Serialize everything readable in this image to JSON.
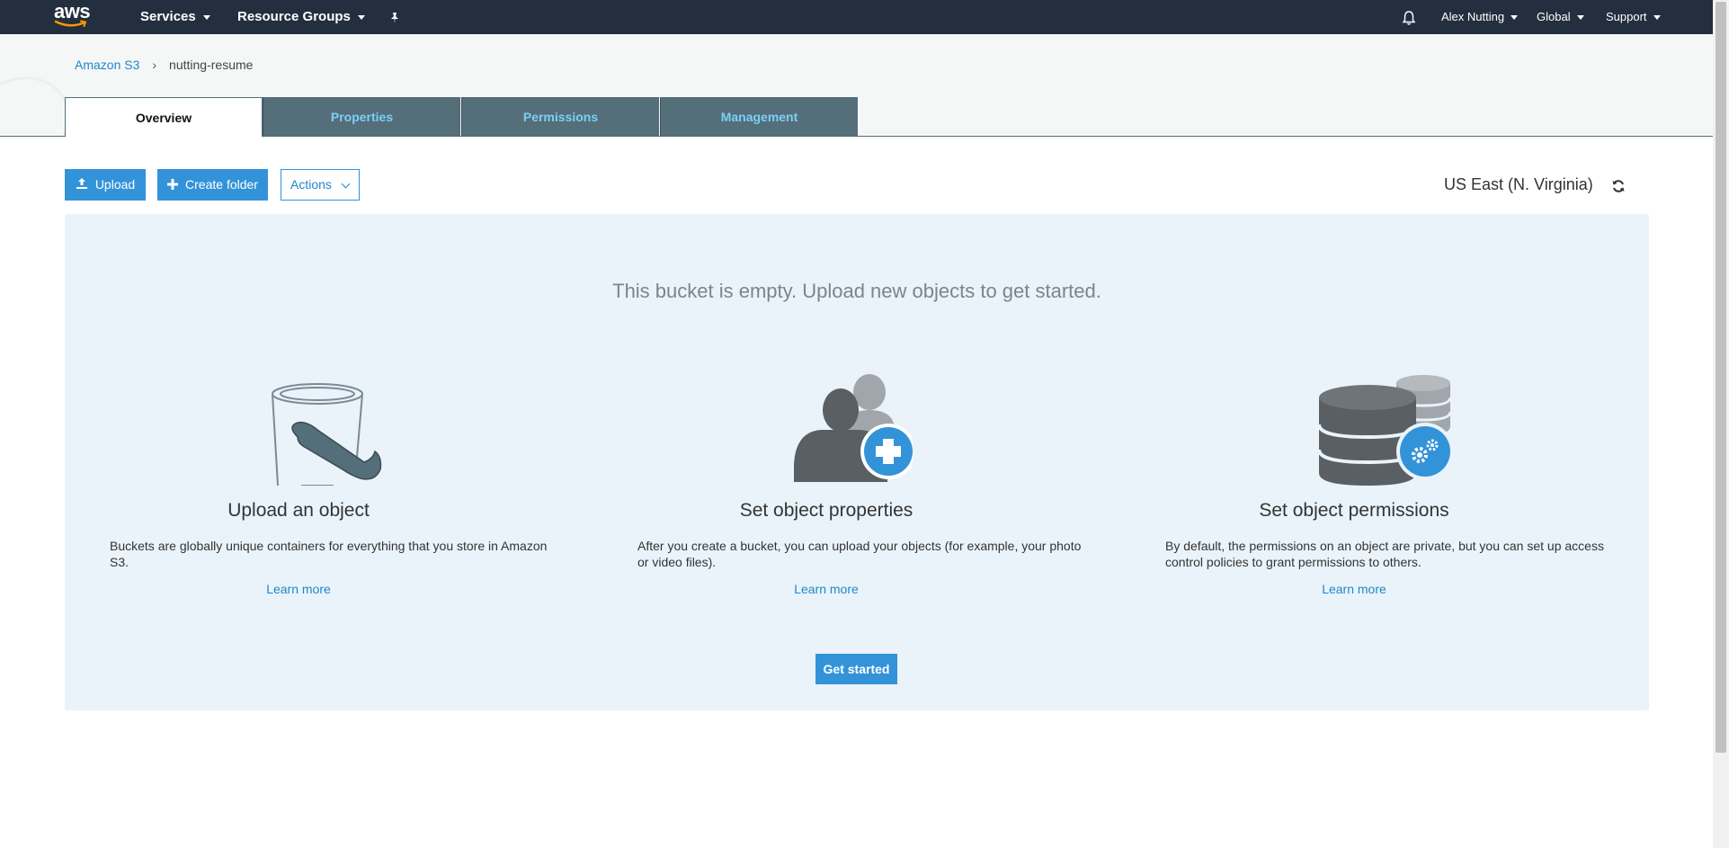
{
  "topnav": {
    "logo_text": "aws",
    "services_label": "Services",
    "resource_groups_label": "Resource Groups",
    "user_label": "Alex Nutting",
    "region_menu_label": "Global",
    "support_label": "Support"
  },
  "breadcrumb": {
    "root": "Amazon S3",
    "separator": "›",
    "current": "nutting-resume"
  },
  "tabs": [
    {
      "label": "Overview",
      "active": true
    },
    {
      "label": "Properties",
      "active": false
    },
    {
      "label": "Permissions",
      "active": false
    },
    {
      "label": "Management",
      "active": false
    }
  ],
  "toolbar": {
    "upload_label": "Upload",
    "create_folder_label": "Create folder",
    "actions_label": "Actions",
    "region": "US East (N. Virginia)"
  },
  "empty_state": {
    "title": "This bucket is empty. Upload new objects to get started.",
    "columns": [
      {
        "icon": "bucket-icon",
        "heading": "Upload an object",
        "description": "Buckets are globally unique containers for everything that you store in Amazon S3.",
        "link": "Learn more"
      },
      {
        "icon": "users-add-icon",
        "heading": "Set object properties",
        "description": "After you create a bucket, you can upload your objects (for example, your photo or video files).",
        "link": "Learn more"
      },
      {
        "icon": "database-settings-icon",
        "heading": "Set object permissions",
        "description": "By default, the permissions on an object are private, but you can set up access control policies to grant permissions to others.",
        "link": "Learn more"
      }
    ],
    "cta_label": "Get started"
  },
  "colors": {
    "nav_bg": "#232f3e",
    "accent": "#3393d9",
    "tab_inactive_bg": "#546e7a",
    "panel_bg": "#eaf3fa"
  }
}
